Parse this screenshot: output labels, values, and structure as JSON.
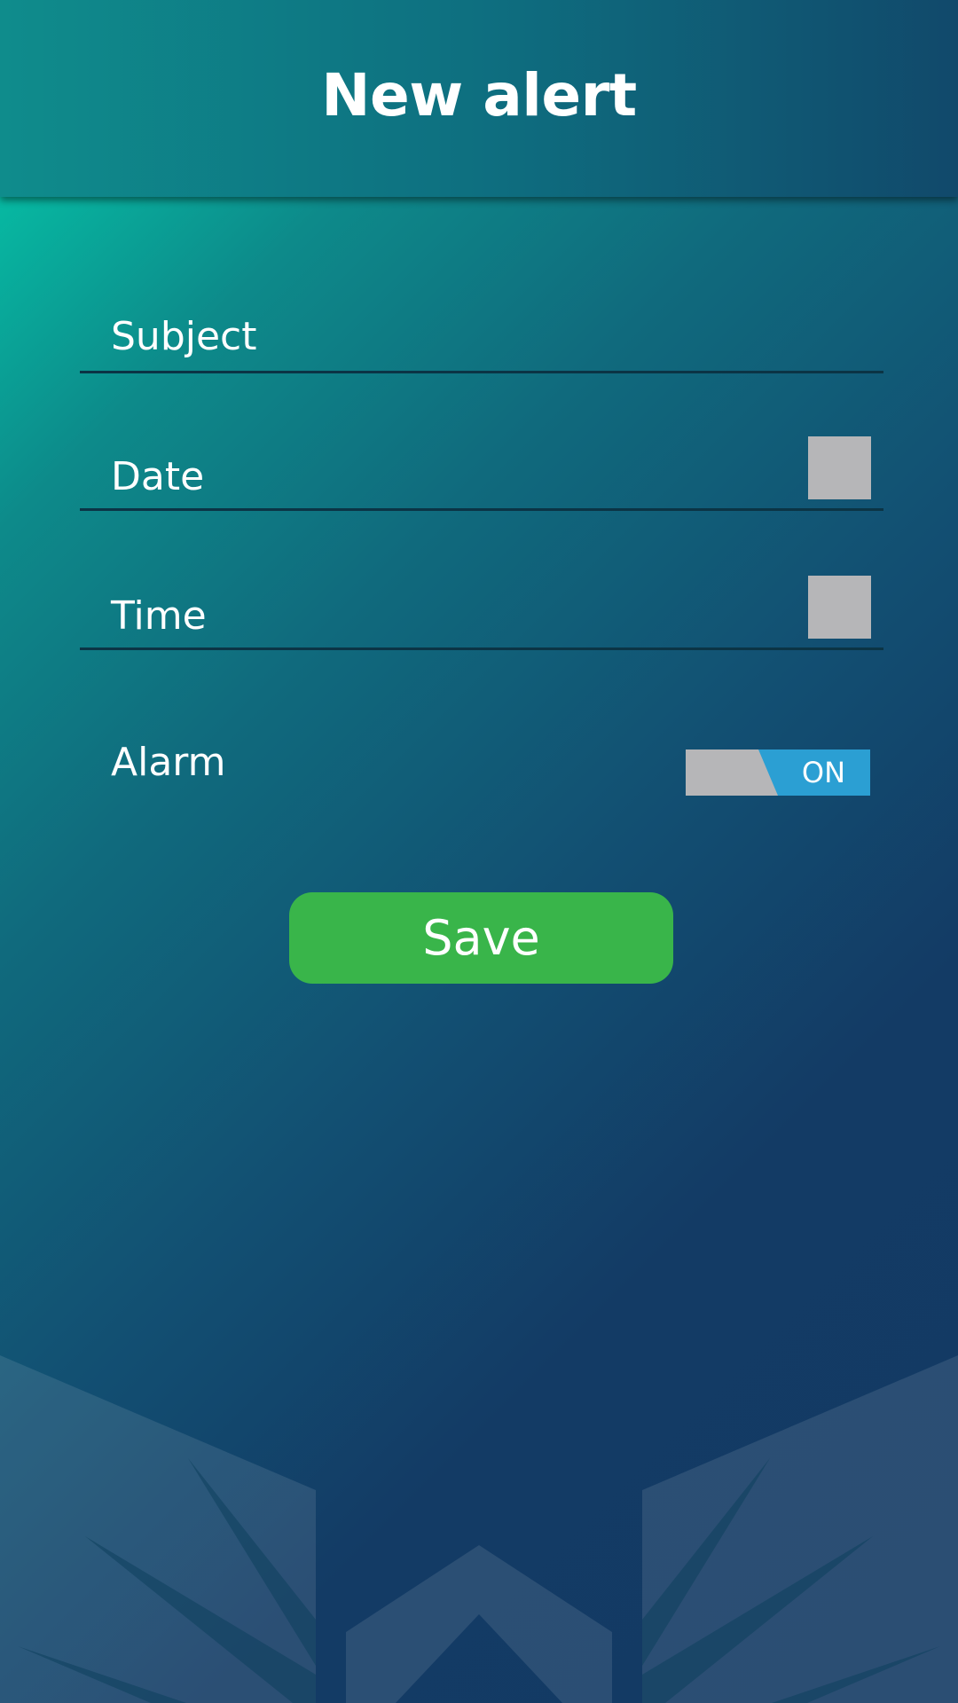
{
  "header": {
    "title": "New alert"
  },
  "form": {
    "subject_label": "Subject",
    "date_label": "Date",
    "time_label": "Time",
    "alarm_label": "Alarm",
    "alarm_toggle_text": "ON",
    "save_label": "Save"
  },
  "colors": {
    "save_button": "#39b54a",
    "toggle_on": "#2b9fd3",
    "toggle_off": "#b6b6b8",
    "picker_box": "#b6b6b8",
    "field_underline": "#0b3445",
    "background_top_left": "#03d4b0",
    "background_bottom_right": "#133a64"
  },
  "icons": {
    "decoration": "abstract-shield-pattern"
  }
}
